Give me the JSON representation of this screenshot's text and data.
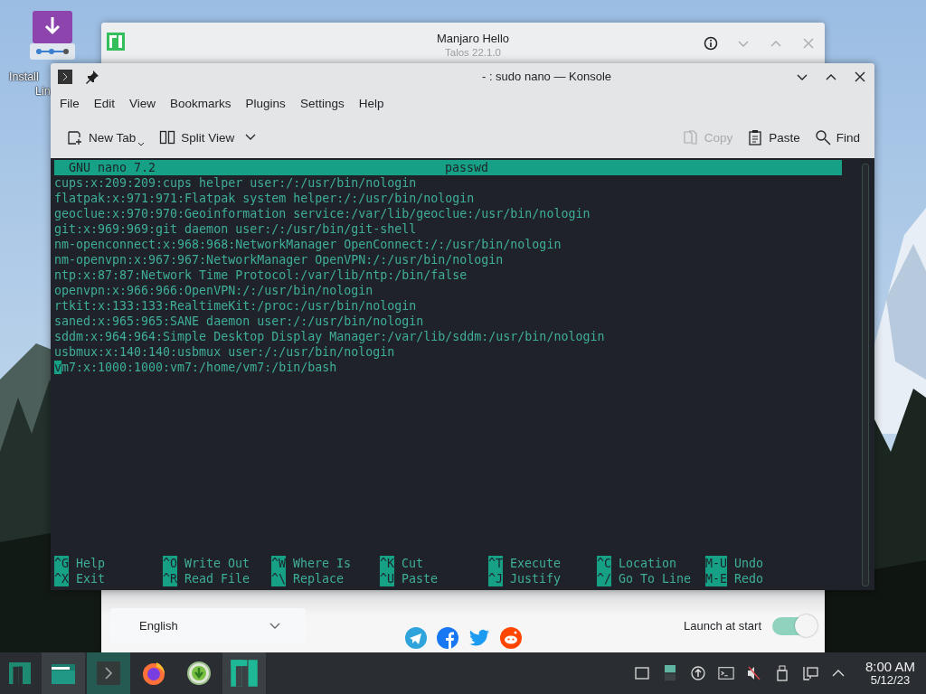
{
  "desktop": {
    "icons": [
      {
        "label_lines": [
          "Install",
          "Lin"
        ]
      }
    ]
  },
  "hello_window": {
    "title": "Manjaro Hello",
    "subtitle": "Talos 22.1.0",
    "language": "English",
    "launch_at_start": {
      "label": "Launch at start",
      "on": true
    }
  },
  "konsole": {
    "title": "- : sudo nano — Konsole",
    "menu": [
      "File",
      "Edit",
      "View",
      "Bookmarks",
      "Plugins",
      "Settings",
      "Help"
    ],
    "toolbar": [
      {
        "kind": "new-tab",
        "label": "New Tab",
        "disabled": false
      },
      {
        "kind": "split-view",
        "label": "Split View",
        "disabled": false
      },
      {
        "kind": "copy",
        "label": "Copy",
        "disabled": true
      },
      {
        "kind": "paste",
        "label": "Paste",
        "disabled": false
      },
      {
        "kind": "find",
        "label": "Find",
        "disabled": false
      }
    ],
    "nano": {
      "version": "GNU nano 7.2",
      "filename": "passwd",
      "lines": [
        {
          "text": "cups:x:209:209:cups helper user:/:/usr/bin/nologin",
          "cursor": false
        },
        {
          "text": "flatpak:x:971:971:Flatpak system helper:/:/usr/bin/nologin",
          "cursor": false
        },
        {
          "text": "geoclue:x:970:970:Geoinformation service:/var/lib/geoclue:/usr/bin/nologin",
          "cursor": false
        },
        {
          "text": "git:x:969:969:git daemon user:/:/usr/bin/git-shell",
          "cursor": false
        },
        {
          "text": "nm-openconnect:x:968:968:NetworkManager OpenConnect:/:/usr/bin/nologin",
          "cursor": false
        },
        {
          "text": "nm-openvpn:x:967:967:NetworkManager OpenVPN:/:/usr/bin/nologin",
          "cursor": false
        },
        {
          "text": "ntp:x:87:87:Network Time Protocol:/var/lib/ntp:/bin/false",
          "cursor": false
        },
        {
          "text": "openvpn:x:966:966:OpenVPN:/:/usr/bin/nologin",
          "cursor": false
        },
        {
          "text": "rtkit:x:133:133:RealtimeKit:/proc:/usr/bin/nologin",
          "cursor": false
        },
        {
          "text": "saned:x:965:965:SANE daemon user:/:/usr/bin/nologin",
          "cursor": false
        },
        {
          "text": "sddm:x:964:964:Simple Desktop Display Manager:/var/lib/sddm:/usr/bin/nologin",
          "cursor": false
        },
        {
          "text": "usbmux:x:140:140:usbmux user:/:/usr/bin/nologin",
          "cursor": false
        },
        {
          "text": "vm7:x:1000:1000:vm7:/home/vm7:/bin/bash",
          "cursor": true
        }
      ],
      "shortcut_rows": [
        [
          {
            "key": "^G",
            "label": "Help"
          },
          {
            "key": "^O",
            "label": "Write Out"
          },
          {
            "key": "^W",
            "label": "Where Is"
          },
          {
            "key": "^K",
            "label": "Cut"
          },
          {
            "key": "^T",
            "label": "Execute"
          },
          {
            "key": "^C",
            "label": "Location"
          },
          {
            "key": "M-U",
            "label": "Undo"
          }
        ],
        [
          {
            "key": "^X",
            "label": "Exit"
          },
          {
            "key": "^R",
            "label": "Read File"
          },
          {
            "key": "^\\",
            "label": "Replace"
          },
          {
            "key": "^U",
            "label": "Paste"
          },
          {
            "key": "^J",
            "label": "Justify"
          },
          {
            "key": "^/",
            "label": "Go To Line"
          },
          {
            "key": "M-E",
            "label": "Redo"
          }
        ]
      ]
    }
  },
  "taskbar": {
    "apps": [
      {
        "kind": "files",
        "open": true,
        "selected": false
      },
      {
        "kind": "terminal",
        "open": true,
        "selected": true
      },
      {
        "kind": "browser",
        "open": false,
        "selected": false
      },
      {
        "kind": "installer",
        "open": false,
        "selected": false
      },
      {
        "kind": "hello",
        "open": true,
        "selected": false
      }
    ],
    "clock": {
      "time": "8:00 AM",
      "date": "5/12/23"
    }
  }
}
